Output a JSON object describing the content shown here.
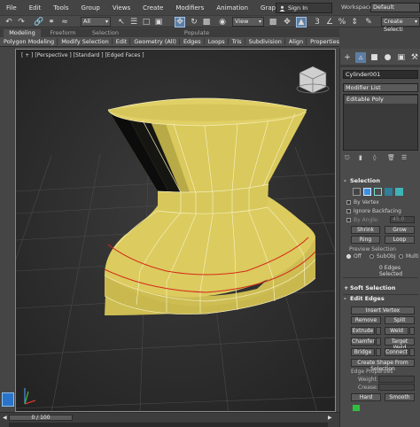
{
  "menubar": {
    "items": [
      "File",
      "Edit",
      "Tools",
      "Group",
      "Views",
      "Create",
      "Modifiers",
      "Animation",
      "Graph Editors"
    ],
    "sign_in": "Sign In",
    "workspaces_label": "Workspaces:",
    "workspaces_value": "Default"
  },
  "toolbar": {
    "selection_filter": "All",
    "ref_coord": "View",
    "named_selection": "Create Selecti"
  },
  "ribbon": {
    "tabs": [
      "Modeling",
      "Freeform",
      "Selection",
      "Populate"
    ],
    "active_tab": "Modeling",
    "panels": [
      "Polygon Modeling",
      "Modify Selection",
      "Edit",
      "Geometry (All)",
      "Edges",
      "Loops",
      "Tris",
      "Subdivision",
      "Align",
      "Properties"
    ]
  },
  "viewport": {
    "label": "[ + ] [Perspective ] [Standard ] [Edged Faces ]"
  },
  "command_panel": {
    "object_name": "Cylinder001",
    "modifier_list": "Modifier List",
    "stack_item": "Editable Poly",
    "selection": {
      "title": "Selection",
      "sign": "-",
      "by_vertex": "By Vertex",
      "ignore_backfacing": "Ignore Backfacing",
      "by_angle": "By Angle:",
      "by_angle_value": "45.0",
      "shrink": "Shrink",
      "grow": "Grow",
      "ring": "Ring",
      "loop": "Loop",
      "preview_selection": "Preview Selection",
      "off": "Off",
      "subobj": "SubObj",
      "multi": "Multi",
      "status": "0 Edges Selected"
    },
    "soft_selection": {
      "title": "Soft Selection",
      "sign": "+"
    },
    "edit_edges": {
      "title": "Edit Edges",
      "sign": "-",
      "insert_vertex": "Insert Vertex",
      "remove": "Remove",
      "split": "Split",
      "extrude": "Extrude",
      "weld": "Weld",
      "chamfer": "Chamfer",
      "target_weld": "Target Weld",
      "bridge": "Bridge",
      "connect": "Connect",
      "create_shape": "Create Shape From Selection",
      "edge_properties": "Edge Properties",
      "weight": "Weight:",
      "crease": "Crease:",
      "hard": "Hard",
      "smooth": "Smooth"
    }
  },
  "timeline": {
    "frame": "0 / 100"
  },
  "colors": {
    "model_fill": "#d6c65a",
    "model_edges": "#f7f3c8",
    "selected_loop": "#d42a1a",
    "viewport_bg": "#2b2b2b",
    "accent_blue": "#2a73c8"
  }
}
